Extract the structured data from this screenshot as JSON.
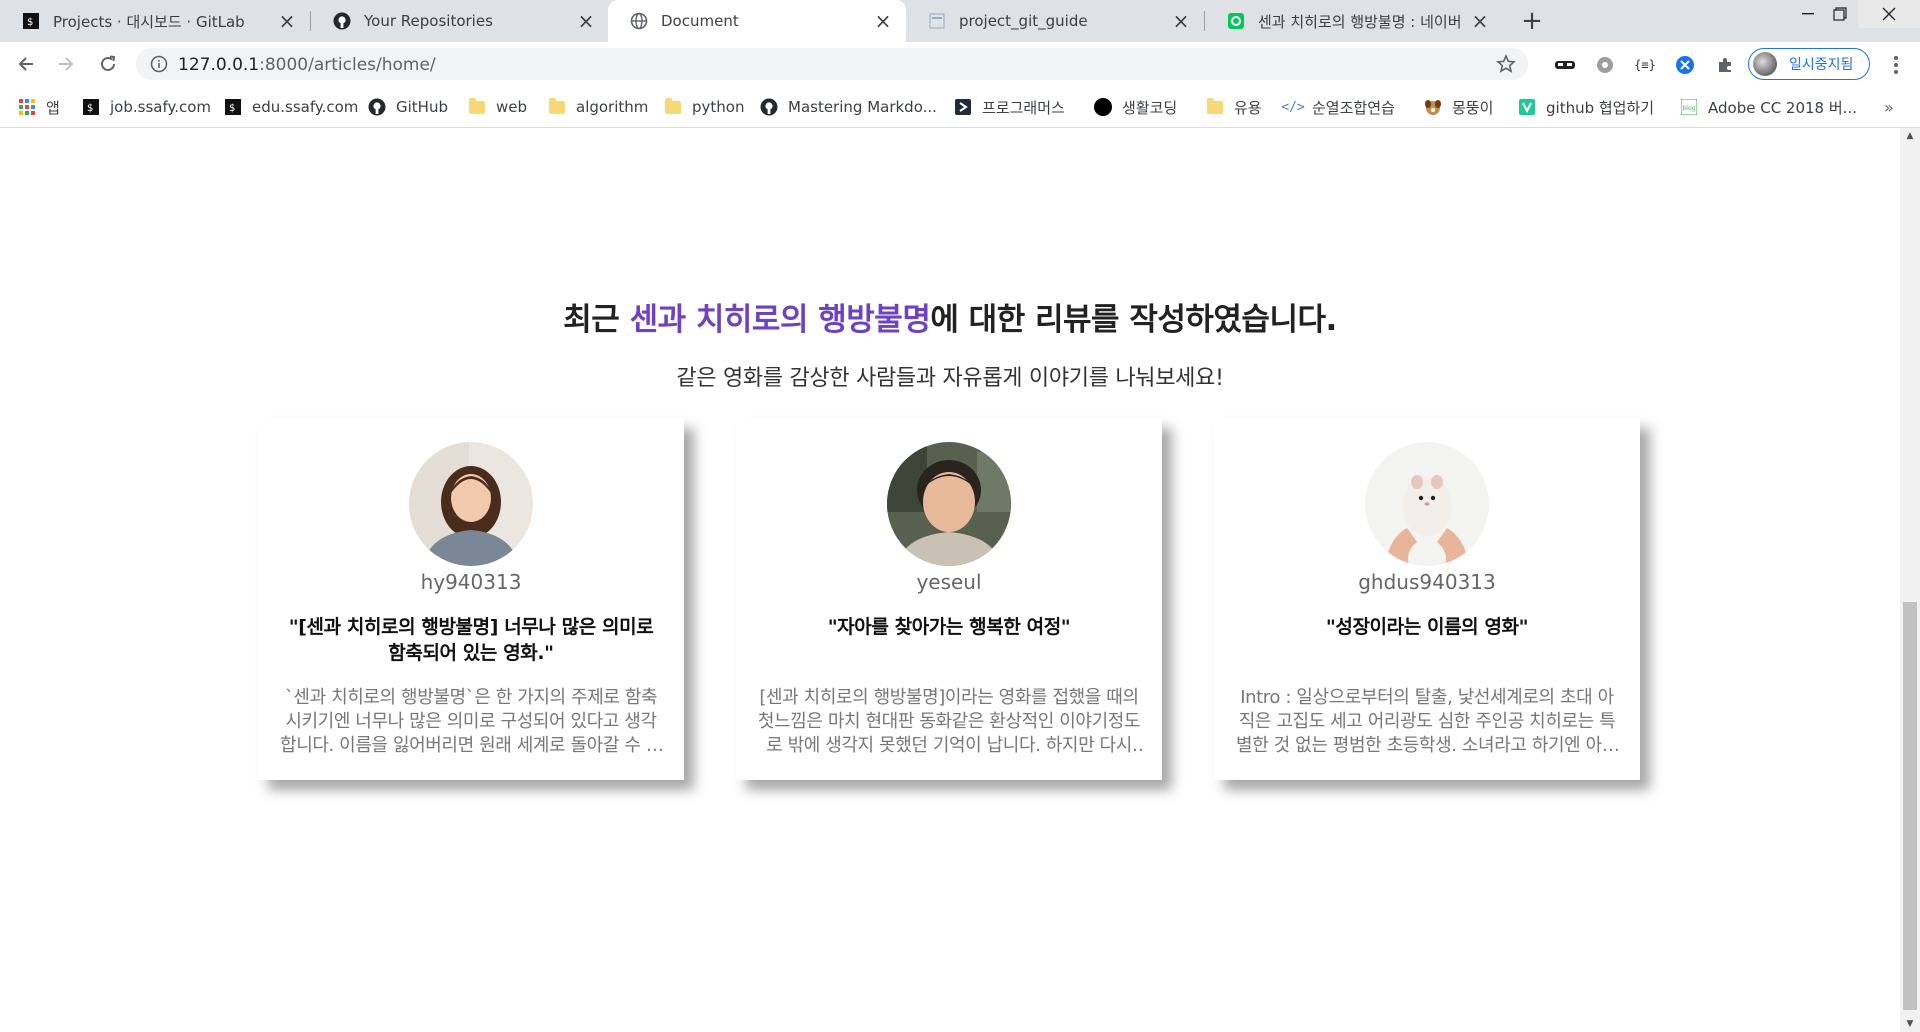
{
  "tabs": [
    {
      "title": "Projects · 대시보드 · GitLab",
      "icon": "gitlab-icon",
      "active": false
    },
    {
      "title": "Your Repositories",
      "icon": "github-icon",
      "active": false
    },
    {
      "title": "Document",
      "icon": "globe-icon",
      "active": true
    },
    {
      "title": "project_git_guide",
      "icon": "doc-icon",
      "active": false
    },
    {
      "title": "센과 치히로의 행방불명 : 네이버",
      "icon": "naver-icon",
      "active": false
    }
  ],
  "toolbar": {
    "url_host": "127.0.0.1",
    "url_path": ":8000/articles/home/",
    "profile_label": "일시중지됨"
  },
  "bookmarks": [
    {
      "label": "앱",
      "icon": "apps-grid-icon"
    },
    {
      "label": "job.ssafy.com",
      "icon": "ssafy-icon"
    },
    {
      "label": "edu.ssafy.com",
      "icon": "ssafy-icon"
    },
    {
      "label": "GitHub",
      "icon": "github-icon"
    },
    {
      "label": "web",
      "icon": "folder-icon"
    },
    {
      "label": "algorithm",
      "icon": "folder-icon"
    },
    {
      "label": "python",
      "icon": "folder-icon"
    },
    {
      "label": "Mastering Markdo...",
      "icon": "github-icon"
    },
    {
      "label": "프로그래머스",
      "icon": "programmers-icon"
    },
    {
      "label": "생활코딩",
      "icon": "circle-icon"
    },
    {
      "label": "유용",
      "icon": "folder-icon"
    },
    {
      "label": "순열조합연습",
      "icon": "code-icon"
    },
    {
      "label": "몽뚱이",
      "icon": "dog-icon"
    },
    {
      "label": "github 협업하기",
      "icon": "velog-icon"
    },
    {
      "label": "Adobe CC 2018 버...",
      "icon": "blog-icon"
    }
  ],
  "page": {
    "headline_prefix": "최근 ",
    "headline_highlight": "센과 치히로의 행방불명",
    "headline_suffix": "에 대한 리뷰를 작성하였습니다.",
    "subline": "같은 영화를 감상한 사람들과 자유롭게 이야기를 나눠보세요!",
    "highlight_color": "#6f42c1"
  },
  "reviews": [
    {
      "username": "hy940313",
      "title": "\"[센과 치히로의 행방불명] 너무나 많은 의미로 함축되어 있는 영화.\"",
      "excerpt": "`센과 치히로의 행방불명`은 한 가지의 주제로 함축시키기엔 너무나 많은 의미로 구성되어 있다고 생각합니다. 이름을 잃어버리면 원래 세계로 돌아갈 수 없다는 설정이 인상적이었습니다."
    },
    {
      "username": "yeseul",
      "title": "\"자아를 찾아가는 행복한 여정\"",
      "excerpt": "[센과 치히로의 행방불명]이라는 영화를 접했을 때의 첫느낌은 마치 현대판 동화같은 환상적인 이야기정도로 밖에 생각지 못했던 기억이 납니다. 하지만 다시 보니 달랐습니다."
    },
    {
      "username": "ghdus940313",
      "title": "\"성장이라는 이름의 영화\"",
      "excerpt": "Intro : 일상으로부터의 탈출, 낯선세계로의 초대 아직은 고집도 세고 어리광도 심한 주인공 치히로는 특별한 것 없는 평범한 초등학생. 소녀라고 하기엔 아직 어린 아이입니다."
    }
  ]
}
